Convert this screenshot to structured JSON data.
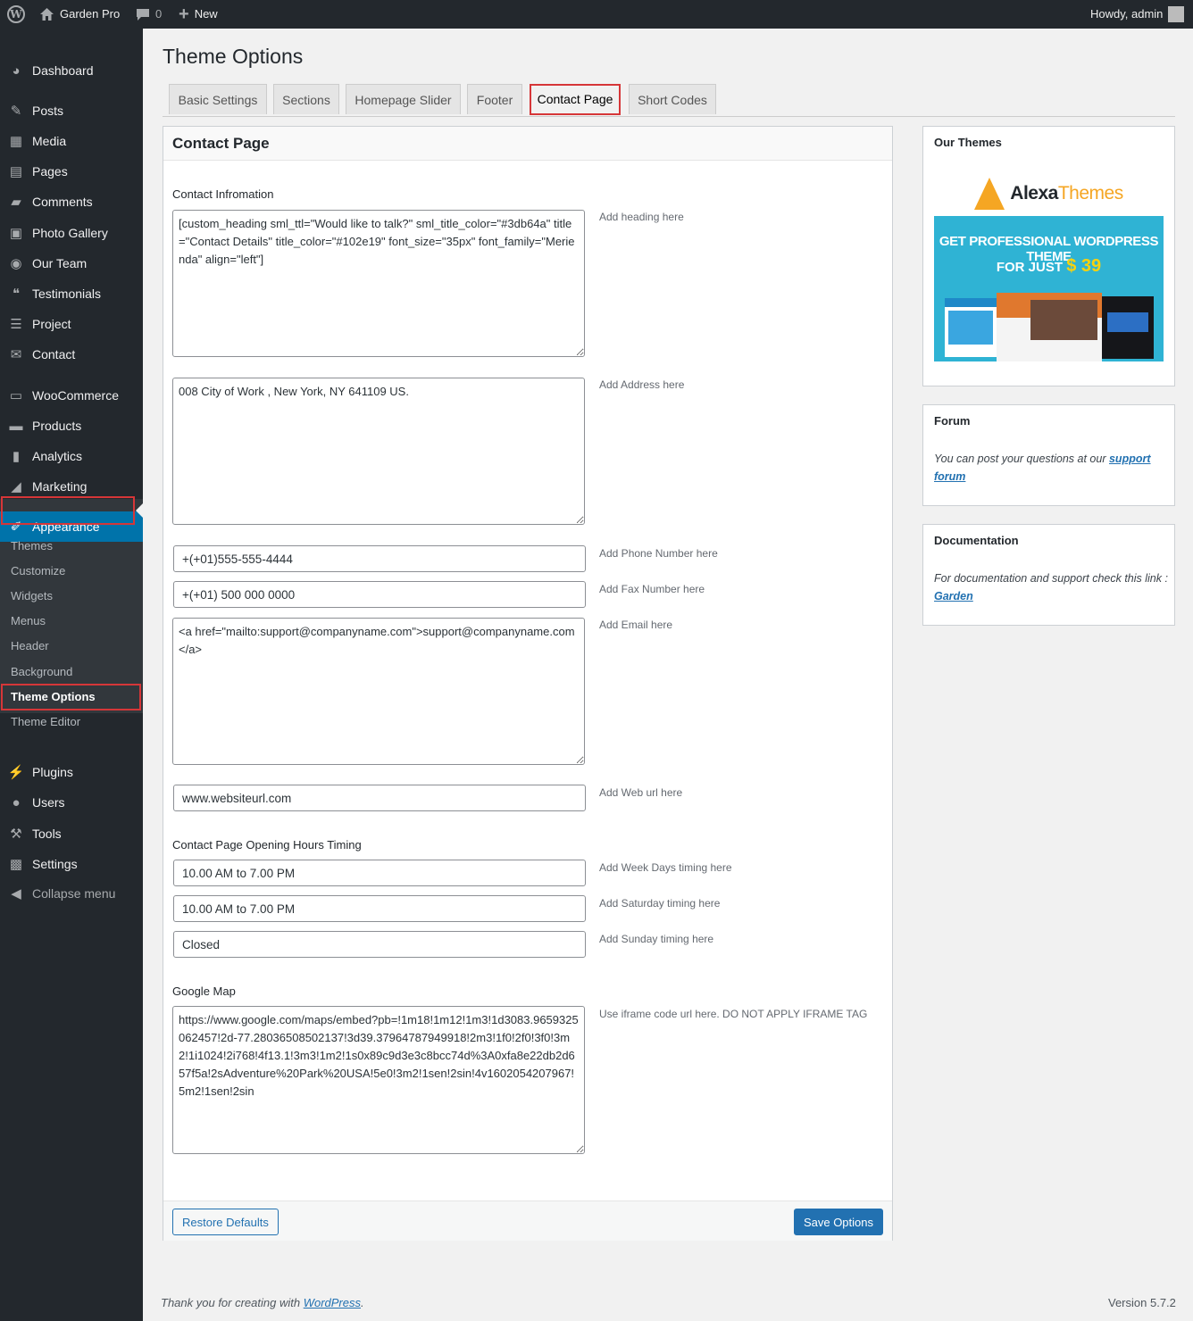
{
  "adminbar": {
    "site_name": "Garden Pro",
    "comments_count": "0",
    "new_label": "New",
    "howdy": "Howdy, admin"
  },
  "sidebar": {
    "items": [
      {
        "label": "Dashboard",
        "icon": "dashboard-icon"
      },
      {
        "label": "Posts",
        "icon": "pin-icon"
      },
      {
        "label": "Media",
        "icon": "media-icon"
      },
      {
        "label": "Pages",
        "icon": "pages-icon"
      },
      {
        "label": "Comments",
        "icon": "comment-icon"
      },
      {
        "label": "Photo Gallery",
        "icon": "gallery-icon"
      },
      {
        "label": "Our Team",
        "icon": "team-icon"
      },
      {
        "label": "Testimonials",
        "icon": "quote-icon"
      },
      {
        "label": "Project",
        "icon": "list-icon"
      },
      {
        "label": "Contact",
        "icon": "mail-icon"
      },
      {
        "label": "WooCommerce",
        "icon": "woo-icon"
      },
      {
        "label": "Products",
        "icon": "archive-icon"
      },
      {
        "label": "Analytics",
        "icon": "bar-chart-icon"
      },
      {
        "label": "Marketing",
        "icon": "megaphone-icon"
      },
      {
        "label": "Appearance",
        "icon": "brush-icon"
      },
      {
        "label": "Plugins",
        "icon": "plug-icon"
      },
      {
        "label": "Users",
        "icon": "user-icon"
      },
      {
        "label": "Tools",
        "icon": "wrench-icon"
      },
      {
        "label": "Settings",
        "icon": "settings-icon"
      },
      {
        "label": "Collapse menu",
        "icon": "collapse-icon"
      }
    ],
    "submenu": [
      "Themes",
      "Customize",
      "Widgets",
      "Menus",
      "Header",
      "Background",
      "Theme Options",
      "Theme Editor"
    ]
  },
  "page": {
    "title": "Theme Options",
    "tabs": [
      "Basic Settings",
      "Sections",
      "Homepage Slider",
      "Footer",
      "Contact Page",
      "Short Codes"
    ],
    "panel_title": "Contact Page",
    "contact_info_label": "Contact Infromation",
    "heading_value": "[custom_heading sml_ttl=\"Would like to talk?\" sml_title_color=\"#3db64a\" title=\"Contact Details\" title_color=\"#102e19\" font_size=\"35px\" font_family=\"Merienda\" align=\"left\"]",
    "heading_hint": "Add heading here",
    "address_value": "008 City of Work , New York, NY 641109 US.",
    "address_hint": "Add Address here",
    "phone_value": "+(+01)555-555-4444",
    "phone_hint": "Add Phone Number here",
    "fax_value": "+(+01) 500 000 0000",
    "fax_hint": "Add Fax Number here",
    "email_value": "<a href=\"mailto:support@companyname.com\">support@companyname.com</a>",
    "email_hint": "Add Email here",
    "web_value": "www.websiteurl.com",
    "web_hint": "Add Web url here",
    "hours_label": "Contact Page Opening Hours Timing",
    "weekdays_value": "10.00 AM to 7.00 PM",
    "weekdays_hint": "Add Week Days timing here",
    "saturday_value": "10.00 AM to 7.00 PM",
    "saturday_hint": "Add Saturday timing here",
    "sunday_value": "Closed",
    "sunday_hint": "Add Sunday timing here",
    "map_label": "Google Map",
    "map_value": "https://www.google.com/maps/embed?pb=!1m18!1m12!1m3!1d3083.9659325062457!2d-77.28036508502137!3d39.37964787949918!2m3!1f0!2f0!3f0!3m2!1i1024!2i768!4f13.1!3m3!1m2!1s0x89c9d3e3c8bcc74d%3A0xfa8e22db2d657f5a!2sAdventure%20Park%20USA!5e0!3m2!1sen!2sin!4v1602054207967!5m2!1sen!2sin",
    "map_hint": "Use iframe code url here. DO NOT APPLY IFRAME TAG",
    "restore_label": "Restore Defaults",
    "save_label": "Save Options"
  },
  "side": {
    "themes_title": "Our Themes",
    "brand_main": "Alexa",
    "brand_accent": "Themes",
    "promo_line1": "GET PROFESSIONAL WORDPRESS THEME",
    "promo_line2": "FOR JUST",
    "promo_price": "$ 39",
    "forum_title": "Forum",
    "forum_text": "You can post your questions at our",
    "forum_link": "support forum",
    "doc_title": "Documentation",
    "doc_text": "For documentation and support check this link :",
    "doc_link": "Garden"
  },
  "footer": {
    "thanks": "Thank you for creating with",
    "wp_link": "WordPress",
    "version": "Version 5.7.2"
  },
  "colors": {
    "adminbar": "#23282d",
    "active_menu": "#0073aa",
    "highlight_outline": "#d63638",
    "primary_button": "#2271b1"
  }
}
